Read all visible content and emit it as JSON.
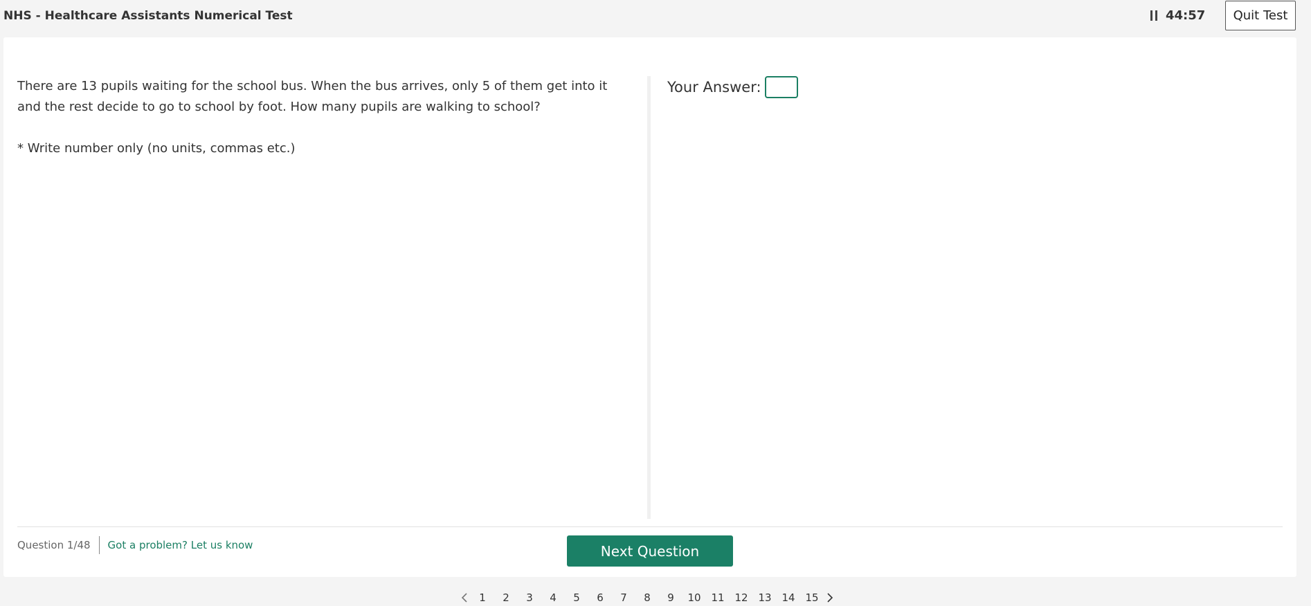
{
  "header": {
    "title": "NHS - Healthcare Assistants Numerical Test",
    "timer": "44:57",
    "quit_label": "Quit Test"
  },
  "question": {
    "text": "There are 13 pupils waiting for the school bus. When the bus arrives, only 5 of them get into it and the rest decide to go to school by foot. How many pupils are walking to school?",
    "note": "* Write number only (no units, commas etc.)"
  },
  "answer": {
    "label": "Your Answer:",
    "value": ""
  },
  "footer": {
    "counter": "Question 1/48",
    "problem_link": "Got a problem? Let us know",
    "next_label": "Next Question"
  },
  "pagination": {
    "pages": [
      "1",
      "2",
      "3",
      "4",
      "5",
      "6",
      "7",
      "8",
      "9",
      "10",
      "11",
      "12",
      "13",
      "14",
      "15"
    ]
  },
  "colors": {
    "accent": "#1b8066",
    "background": "#f4f4f4",
    "card": "#ffffff"
  },
  "icons": {
    "pause": "pause-icon",
    "prev": "chevron-left-icon",
    "next": "chevron-right-icon"
  }
}
